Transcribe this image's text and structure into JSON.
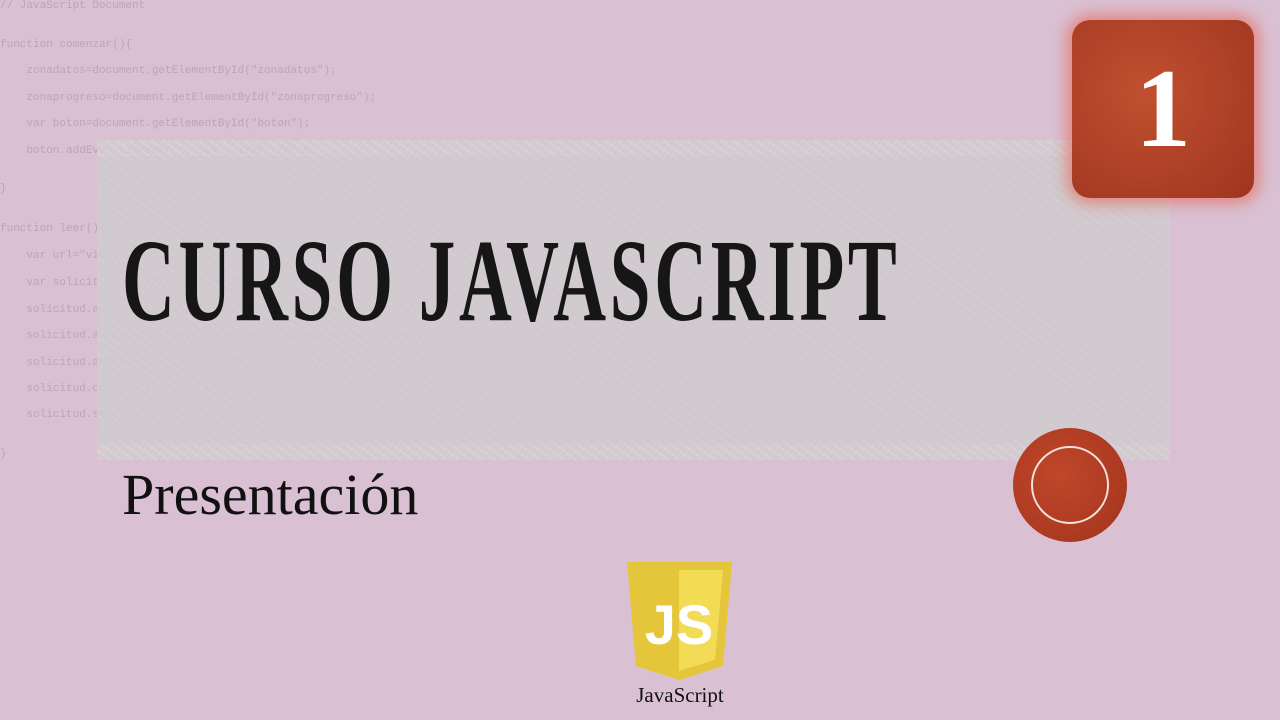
{
  "background_code": [
    "// JavaScript Document",
    "function comenzar(){",
    "    zonadatos=document.getElementById(\"zonadatos\");",
    "    zonaprogreso=document.getElementById(\"zonaprogreso\");",
    "    var boton=document.getElementById(\"boton\");",
    "    boton.addEventListener(\"click\", leer, false);",
    "}",
    "function leer(){",
    "    var url=\"video",
    "    var solicitud=new XMLHttpRequest();",
    "    solicitud.addEventListener(\"loadstart\", comenzar_barra, false);",
    "    solicitud.addEventListener(\"progress\", estado_barra, false);",
    "    solicitud.addEventListener(\"load\", mostrar, false);",
    "    solicitud.open(\"GET\", url, true);",
    "    solicitud.send(null);",
    "}"
  ],
  "slide": {
    "title": "CURSO JAVASCRIPT",
    "subtitle": "Presentación",
    "number": "1",
    "logo_text": "JS",
    "logo_label": "JavaScript"
  },
  "colors": {
    "background": "#d9c1d3",
    "accent_red": "#b5442a",
    "js_yellow": "#f0d43c"
  }
}
